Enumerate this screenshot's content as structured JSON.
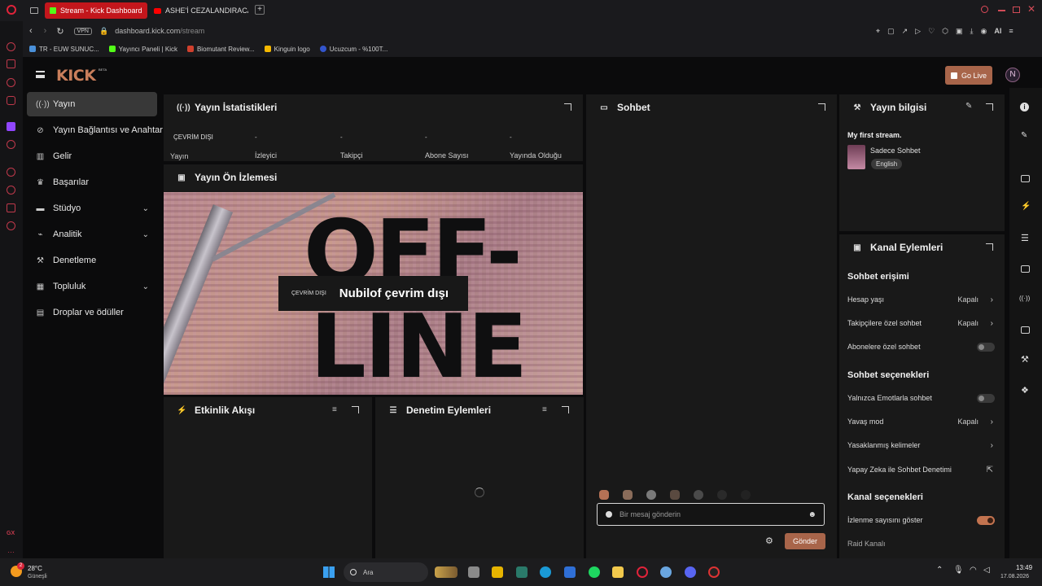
{
  "browser": {
    "tabs": [
      {
        "label": "Stream - Kick Dashboard",
        "active": true
      },
      {
        "label": "ASHE'İ CEZALANDIRACAK!",
        "active": false
      }
    ],
    "vpn_label": "VPN",
    "url_host": "dashboard.kick.com",
    "url_path": "/stream",
    "ai_label": "AI",
    "bookmarks": [
      "TR - EUW SUNUC...",
      "Yayıncı Paneli | Kick",
      "Biomutant Review...",
      "Kinguin logo",
      "Ucuzcum - %100T..."
    ]
  },
  "header": {
    "logo": "KICK",
    "logo_badge": "BETA",
    "go_live": "Go Live"
  },
  "sidebar": {
    "items": [
      {
        "label": "Yayın",
        "icon": "broadcast-icon",
        "active": true
      },
      {
        "label": "Yayın Bağlantısı ve Anahtarı",
        "icon": "link-icon"
      },
      {
        "label": "Gelir",
        "icon": "chart-icon"
      },
      {
        "label": "Başarılar",
        "icon": "trophy-icon"
      },
      {
        "label": "Stüdyo",
        "icon": "studio-icon",
        "expandable": true
      },
      {
        "label": "Analitik",
        "icon": "analytics-icon",
        "expandable": true
      },
      {
        "label": "Denetleme",
        "icon": "wrench-icon"
      },
      {
        "label": "Topluluk",
        "icon": "community-icon",
        "expandable": true
      },
      {
        "label": "Droplar ve ödüller",
        "icon": "drops-icon"
      }
    ]
  },
  "stats": {
    "title": "Yayın İstatistikleri",
    "status": "ÇEVRİM DIŞI",
    "status_label": "Yayın",
    "items": [
      {
        "label": "İzleyici",
        "value": "-"
      },
      {
        "label": "Takipçi",
        "value": "-"
      },
      {
        "label": "Abone Sayısı",
        "value": "-"
      },
      {
        "label": "Yayında Olduğu",
        "value": "-"
      }
    ]
  },
  "preview": {
    "title": "Yayın Ön İzlemesi",
    "bg_text_1": "OFF-",
    "bg_text_2": "LINE",
    "badge": "ÇEVRİM DIŞI",
    "message": "Nubilof çevrim dışı"
  },
  "activity": {
    "title": "Etkinlik Akışı"
  },
  "moderation": {
    "title": "Denetim Eylemleri"
  },
  "chat": {
    "title": "Sohbet",
    "placeholder": "Bir mesaj gönderin",
    "send": "Gönder"
  },
  "stream_info": {
    "title": "Yayın bilgisi",
    "stream_title": "My first stream.",
    "category": "Sadece Sohbet",
    "language": "English"
  },
  "channel_actions": {
    "title": "Kanal Eylemleri",
    "chat_access": {
      "heading": "Sohbet erişimi",
      "rows": [
        {
          "label": "Hesap yaşı",
          "value": "Kapalı"
        },
        {
          "label": "Takipçilere özel sohbet",
          "value": "Kapalı"
        },
        {
          "label": "Abonelere özel sohbet",
          "toggle": false
        }
      ]
    },
    "chat_options": {
      "heading": "Sohbet seçenekleri",
      "rows": [
        {
          "label": "Yalnızca Emotlarla sohbet",
          "toggle": false
        },
        {
          "label": "Yavaş mod",
          "value": "Kapalı"
        },
        {
          "label": "Yasaklanmış kelimeler"
        },
        {
          "label": "Yapay Zeka ile Sohbet Denetimi"
        }
      ]
    },
    "channel_options": {
      "heading": "Kanal seçenekleri",
      "rows": [
        {
          "label": "İzlenme sayısını göster",
          "toggle": true
        },
        {
          "label": "Raid Kanalı"
        }
      ]
    }
  },
  "taskbar": {
    "weather_temp": "28°C",
    "weather_desc": "Güneşli",
    "weather_badge": "2",
    "search": "Ara",
    "time": "13:49",
    "date": "17.08.2026"
  },
  "colors": {
    "kick_green": "#53fc18",
    "accent_copper": "#b8735a",
    "panel": "#191919"
  }
}
